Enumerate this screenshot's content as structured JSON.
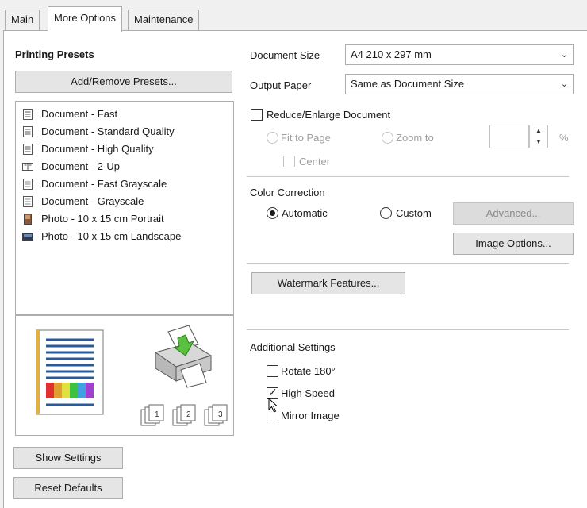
{
  "tabs": [
    {
      "label": "Main"
    },
    {
      "label": "More Options"
    },
    {
      "label": "Maintenance"
    }
  ],
  "active_tab": "More Options",
  "presets": {
    "heading": "Printing Presets",
    "add_remove_label": "Add/Remove Presets...",
    "items": [
      {
        "label": "Document - Fast",
        "icon": "document-icon"
      },
      {
        "label": "Document - Standard Quality",
        "icon": "document-icon"
      },
      {
        "label": "Document - High Quality",
        "icon": "document-icon"
      },
      {
        "label": "Document - 2-Up",
        "icon": "two-up-icon"
      },
      {
        "label": "Document - Fast Grayscale",
        "icon": "document-icon"
      },
      {
        "label": "Document - Grayscale",
        "icon": "document-icon"
      },
      {
        "label": "Photo - 10 x 15 cm Portrait",
        "icon": "photo-portrait-icon"
      },
      {
        "label": "Photo - 10 x 15 cm Landscape",
        "icon": "photo-landscape-icon"
      }
    ]
  },
  "preview": {
    "copy_icons": [
      "collate-copy-1-icon",
      "collate-copy-2-icon",
      "collate-copy-3-icon"
    ]
  },
  "buttons": {
    "show_settings": "Show Settings",
    "reset_defaults": "Reset Defaults"
  },
  "document_size": {
    "label": "Document Size",
    "value": "A4 210 x 297 mm"
  },
  "output_paper": {
    "label": "Output Paper",
    "value": "Same as Document Size"
  },
  "reduce_enlarge": {
    "label": "Reduce/Enlarge Document",
    "checked": false,
    "fit_to_page": "Fit to Page",
    "zoom_to": "Zoom to",
    "zoom_value": "",
    "percent": "%",
    "center": "Center"
  },
  "color_correction": {
    "heading": "Color Correction",
    "automatic": "Automatic",
    "custom": "Custom",
    "selected": "Automatic",
    "advanced": "Advanced...",
    "image_options": "Image Options..."
  },
  "watermark": {
    "label": "Watermark Features..."
  },
  "additional": {
    "heading": "Additional Settings",
    "rotate": {
      "label": "Rotate 180°",
      "checked": false
    },
    "high_speed": {
      "label": "High Speed",
      "checked": true
    },
    "mirror": {
      "label": "Mirror Image",
      "checked": false
    }
  },
  "colors": {
    "panel_bg": "#ffffff",
    "window_bg": "#f0f0f0",
    "button_bg": "#e5e5e5",
    "border": "#adadad",
    "disabled_text": "#a0a0a0"
  }
}
